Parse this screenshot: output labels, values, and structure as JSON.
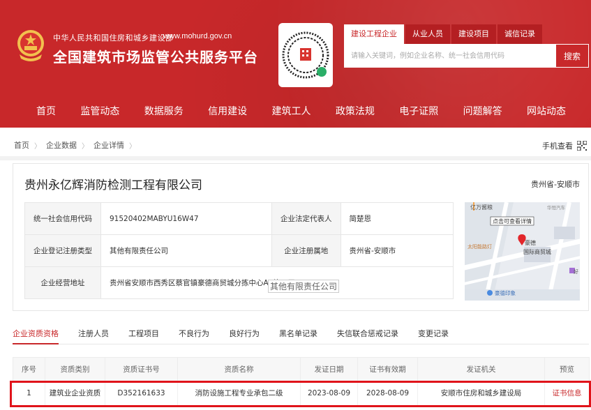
{
  "header": {
    "brand_small": "中华人民共和国住房和城乡建设部",
    "brand_url": "www.mohurd.gov.cn",
    "brand_big": "全国建筑市场监管公共服务平台",
    "search_tabs": [
      "建设工程企业",
      "从业人员",
      "建设项目",
      "诚信记录"
    ],
    "search_placeholder": "请输入关键词，例如企业名称、统一社会信用代码",
    "search_button": "搜索"
  },
  "nav": [
    "首页",
    "监管动态",
    "数据服务",
    "信用建设",
    "建筑工人",
    "政策法规",
    "电子证照",
    "问题解答",
    "网站动态"
  ],
  "breadcrumb": [
    "首页",
    "企业数据",
    "企业详情"
  ],
  "mobile_view": "手机查看",
  "company": {
    "name": "贵州永亿辉消防检测工程有限公司",
    "region": "贵州省-安顺市",
    "credit_code_label": "统一社会信用代码",
    "credit_code": "91520402MABYU16W47",
    "legal_rep_label": "企业法定代表人",
    "legal_rep": "简楚恩",
    "reg_type_label": "企业登记注册类型",
    "reg_type": "其他有限责任公司",
    "reg_place_label": "企业注册属地",
    "reg_place": "贵州省-安顺市",
    "address_label": "企业经营地址",
    "address": "贵州省安顺市西秀区蔡官镇豪德商贸城分拣中心A2栋一层",
    "tooltip": "其他有限责任公司"
  },
  "map": {
    "labels": [
      "亿万酱粮",
      "点击可查看详情",
      "豪德",
      "国际商贸城",
      "太阳能路灯",
      "豪德印象",
      "华恒汽车",
      "好"
    ]
  },
  "tabs": [
    "企业资质资格",
    "注册人员",
    "工程项目",
    "不良行为",
    "良好行为",
    "黑名单记录",
    "失信联合惩戒记录",
    "变更记录"
  ],
  "table": {
    "headers": [
      "序号",
      "资质类别",
      "资质证书号",
      "资质名称",
      "发证日期",
      "证书有效期",
      "发证机关",
      "预览"
    ],
    "rows": [
      [
        "1",
        "建筑业企业资质",
        "D352161633",
        "消防设施工程专业承包二级",
        "2023-08-09",
        "2028-08-09",
        "安顺市住房和城乡建设局",
        "证书信息"
      ]
    ]
  },
  "colors": {
    "brand_red": "#c8282a",
    "highlight": "#e0131a"
  }
}
